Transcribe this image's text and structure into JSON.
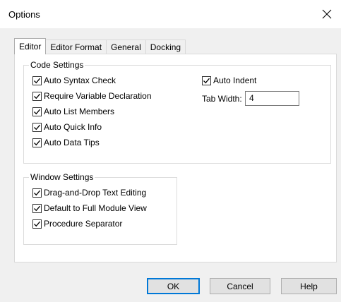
{
  "window": {
    "title": "Options",
    "close_icon": "close-icon"
  },
  "tabs": [
    {
      "label": "Editor",
      "active": true
    },
    {
      "label": "Editor Format",
      "active": false
    },
    {
      "label": "General",
      "active": false
    },
    {
      "label": "Docking",
      "active": false
    }
  ],
  "code_settings": {
    "legend": "Code Settings",
    "options": [
      {
        "label": "Auto Syntax Check",
        "checked": true
      },
      {
        "label": "Require Variable Declaration",
        "checked": true
      },
      {
        "label": "Auto List Members",
        "checked": true
      },
      {
        "label": "Auto Quick Info",
        "checked": true
      },
      {
        "label": "Auto Data Tips",
        "checked": true
      }
    ],
    "auto_indent": {
      "label": "Auto Indent",
      "checked": true
    },
    "tab_width": {
      "label": "Tab Width:",
      "value": "4"
    }
  },
  "window_settings": {
    "legend": "Window Settings",
    "options": [
      {
        "label": "Drag-and-Drop Text Editing",
        "checked": true
      },
      {
        "label": "Default to Full Module View",
        "checked": true
      },
      {
        "label": "Procedure Separator",
        "checked": true
      }
    ]
  },
  "buttons": {
    "ok": "OK",
    "cancel": "Cancel",
    "help": "Help"
  },
  "colors": {
    "accent": "#0078d7",
    "dialog_bg": "#f0f0f0",
    "panel_bg": "#ffffff"
  }
}
